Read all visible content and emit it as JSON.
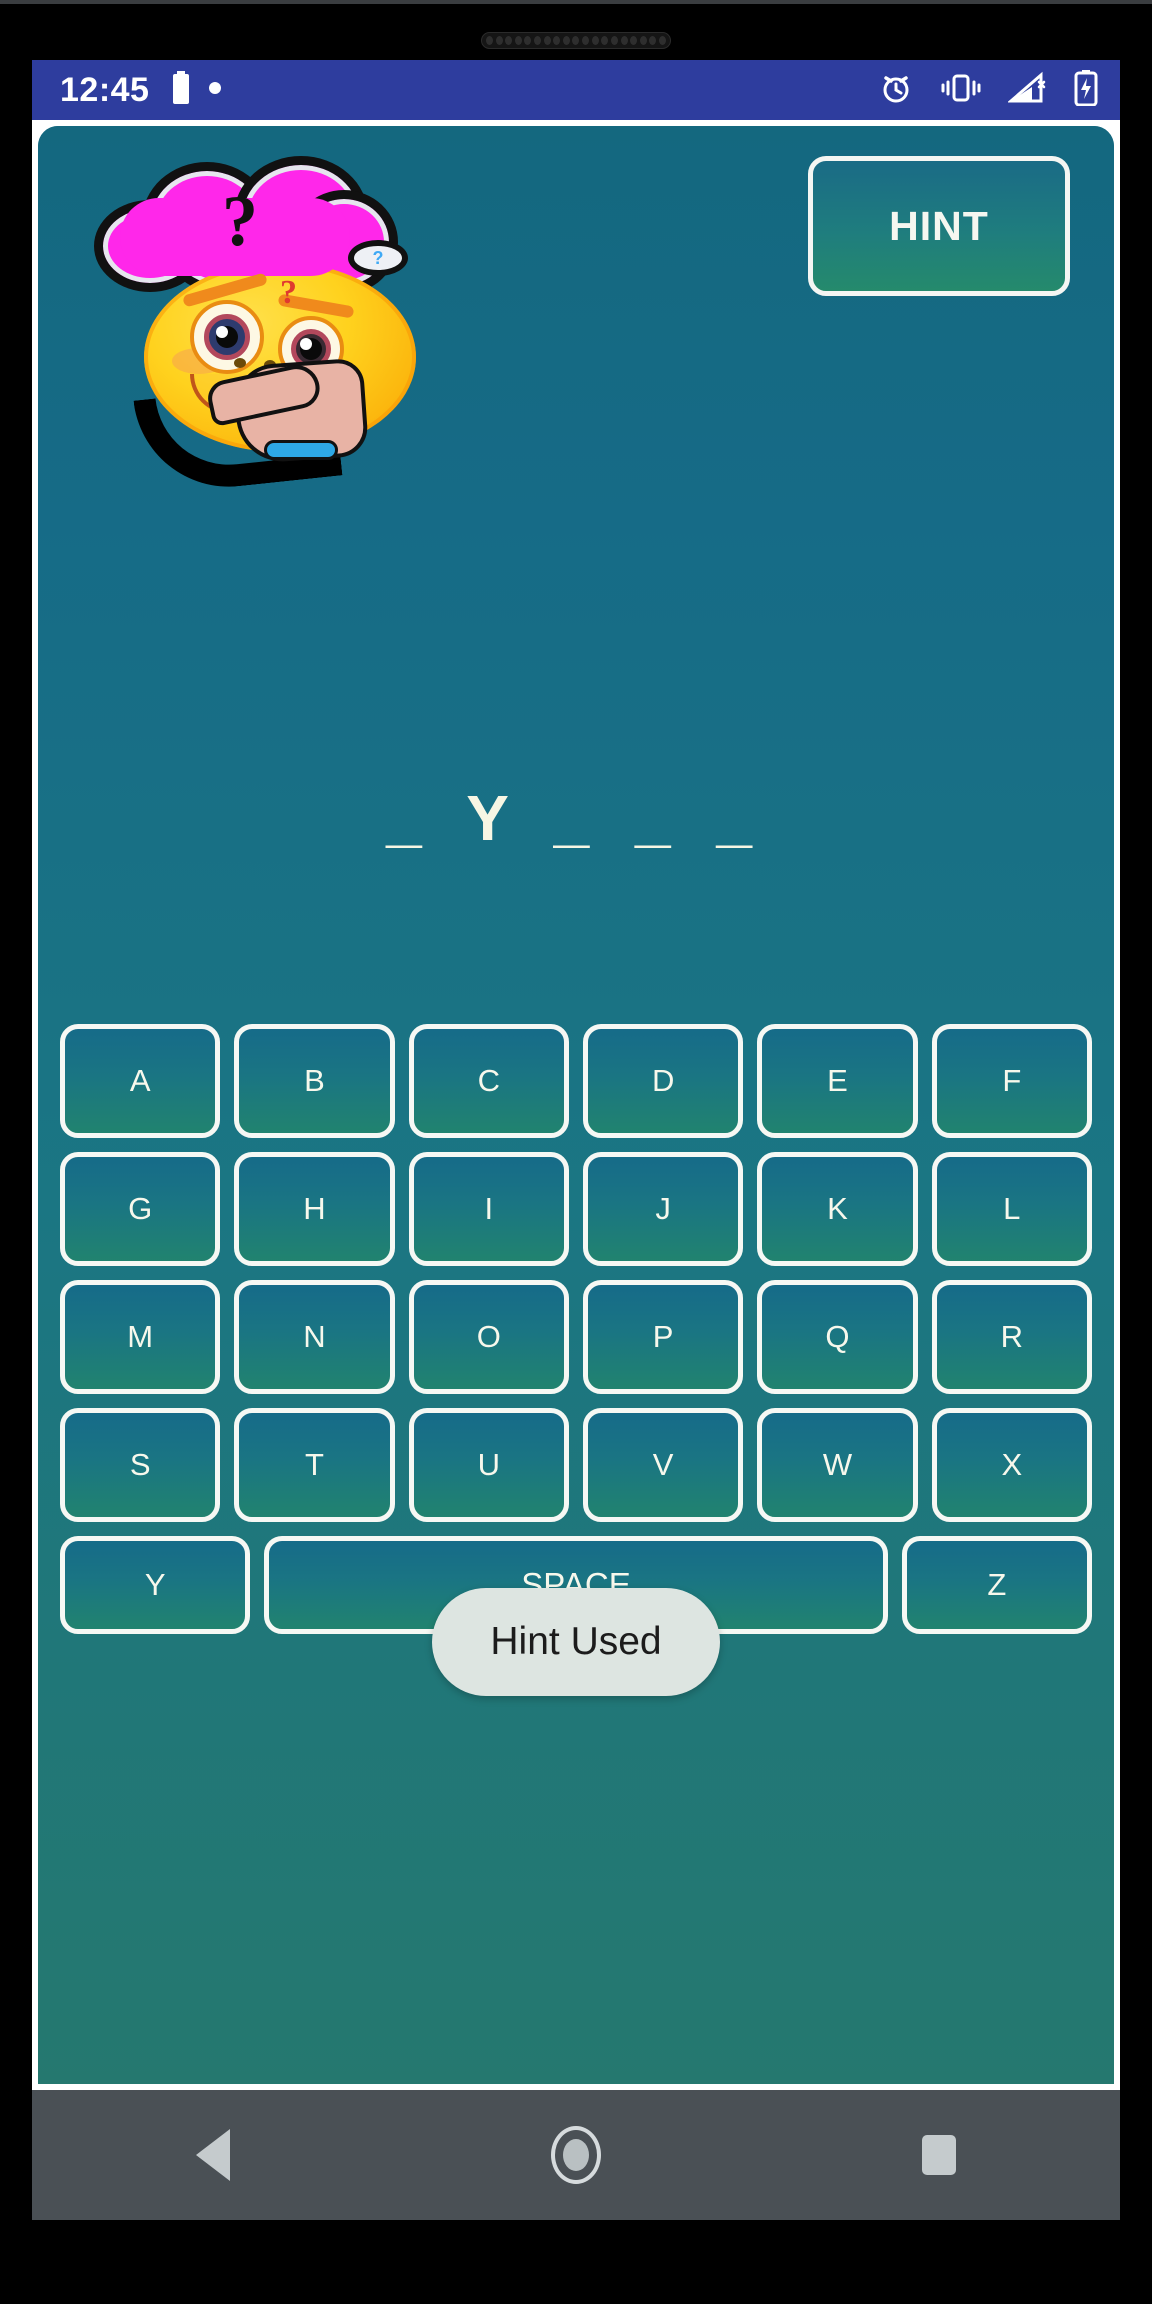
{
  "device": {
    "speaker_dots": 19
  },
  "status_bar": {
    "time": "12:45",
    "background_color": "#2e3d9e",
    "left_icons": [
      "battery-icon",
      "dot-indicator-icon"
    ],
    "right_icons": [
      "alarm-clock-icon",
      "vibrate-icon",
      "signal-off-icon",
      "battery-charging-icon"
    ]
  },
  "app": {
    "background_color": "#166b87",
    "mascot": {
      "name": "thinking-emoji",
      "thought_bubble_text": "?",
      "thought_bubble_color": "#ff27ea",
      "face_question_mark": "?",
      "mini_bubble_text": "?"
    },
    "hint_button": {
      "label": "HINT",
      "border_color": "#f4f6f3"
    },
    "puzzle": {
      "display": "_ Y _ _ _",
      "length": 5,
      "revealed": [
        {
          "index": 1,
          "letter": "Y"
        }
      ],
      "text_color": "#f7f6e4"
    },
    "keyboard": {
      "rows": [
        [
          "A",
          "B",
          "C",
          "D",
          "E",
          "F"
        ],
        [
          "G",
          "H",
          "I",
          "J",
          "K",
          "L"
        ],
        [
          "M",
          "N",
          "O",
          "P",
          "Q",
          "R"
        ],
        [
          "S",
          "T",
          "U",
          "V",
          "W",
          "X"
        ]
      ],
      "last_row": {
        "left_key": "Y",
        "space_key": "SPACE",
        "right_key": "Z"
      },
      "key_border_color": "#f6f8f4",
      "key_text_color": "#f7f8ec"
    },
    "toast": {
      "message": "Hint Used",
      "background_color": "#dde5e1",
      "text_color": "#1c1c1c"
    }
  },
  "nav_bar": {
    "background_color": "#4a5055",
    "items": [
      "back-button",
      "home-button",
      "recents-button"
    ]
  }
}
